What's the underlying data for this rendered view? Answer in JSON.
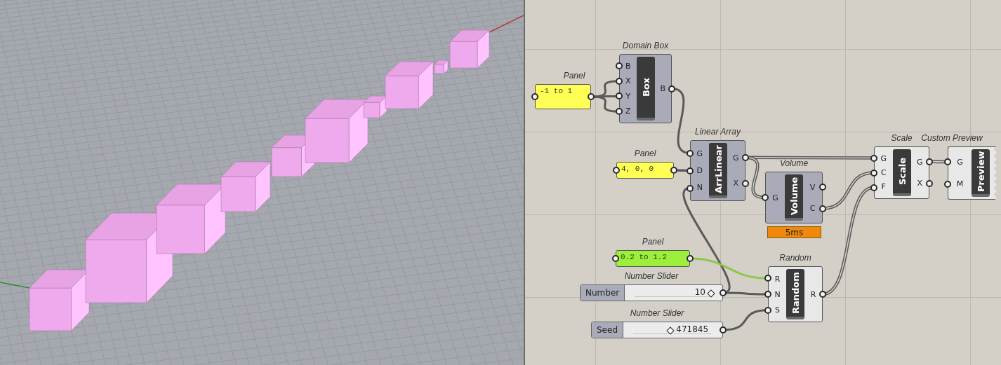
{
  "canvas": {
    "nodes": [
      {
        "kind": "panel",
        "title": "Panel",
        "text": "-1 to 1",
        "selected": false
      },
      {
        "kind": "component",
        "title": "Domain Box",
        "nickname": "Box",
        "inputs": [
          "B",
          "X",
          "Y",
          "Z"
        ],
        "outputs": [
          "B"
        ],
        "preview_hidden": true
      },
      {
        "kind": "component",
        "title": "Linear Array",
        "nickname": "ArrLinear",
        "inputs": [
          "G",
          "D",
          "N"
        ],
        "outputs": [
          "G",
          "X"
        ],
        "preview_hidden": true
      },
      {
        "kind": "panel",
        "title": "Panel",
        "text": "4, 0, 0",
        "selected": false
      },
      {
        "kind": "component",
        "title": "Volume",
        "nickname": "Volume",
        "inputs": [
          "G"
        ],
        "outputs": [
          "V",
          "C"
        ],
        "preview_hidden": true,
        "profiler": "5ms"
      },
      {
        "kind": "component",
        "title": "Scale",
        "nickname": "Scale",
        "inputs": [
          "G",
          "C",
          "F"
        ],
        "outputs": [
          "G",
          "X"
        ],
        "preview_hidden": false
      },
      {
        "kind": "preview",
        "title": "Custom Preview",
        "nickname": "Preview",
        "inputs": [
          "G",
          "M"
        ],
        "preview_hidden": false
      },
      {
        "kind": "panel",
        "title": "Panel",
        "text": "0.2 to 1.2",
        "selected": true
      },
      {
        "kind": "slider",
        "title": "Number Slider",
        "name": "Number",
        "value": "10",
        "level": 1
      },
      {
        "kind": "component",
        "title": "Random",
        "nickname": "Random",
        "inputs": [
          "R",
          "N",
          "S"
        ],
        "outputs": [
          "R"
        ],
        "preview_hidden": false
      },
      {
        "kind": "slider",
        "title": "Number Slider",
        "name": "Seed",
        "value": "471845",
        "level": 0.48
      }
    ]
  }
}
